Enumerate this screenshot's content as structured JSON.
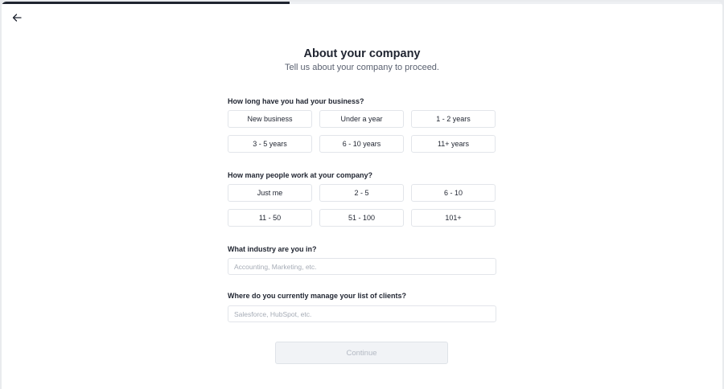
{
  "progress": {
    "value_percent": 40
  },
  "back": {
    "icon": "arrow-left-icon"
  },
  "header": {
    "title": "About your company",
    "subtitle": "Tell us about your company to proceed."
  },
  "q_business_age": {
    "label": "How long have you had your business?",
    "options": [
      "New business",
      "Under a year",
      "1 - 2 years",
      "3 - 5 years",
      "6 - 10 years",
      "11+ years"
    ]
  },
  "q_team_size": {
    "label": "How many people work at your company?",
    "options": [
      "Just me",
      "2 - 5",
      "6 - 10",
      "11 - 50",
      "51 - 100",
      "101+"
    ]
  },
  "q_industry": {
    "label": "What industry are you in?",
    "placeholder": "Accounting, Marketing, etc.",
    "value": ""
  },
  "q_clients": {
    "label": "Where do you currently manage your list of clients?",
    "placeholder": "Salesforce, HubSpot, etc.",
    "value": ""
  },
  "continue": {
    "label": "Continue",
    "disabled": true
  },
  "colors": {
    "accent": "#1f2430",
    "border": "#e2e5ea",
    "disabled_bg": "#f1f3f6",
    "disabled_text": "#b3b9c3"
  }
}
